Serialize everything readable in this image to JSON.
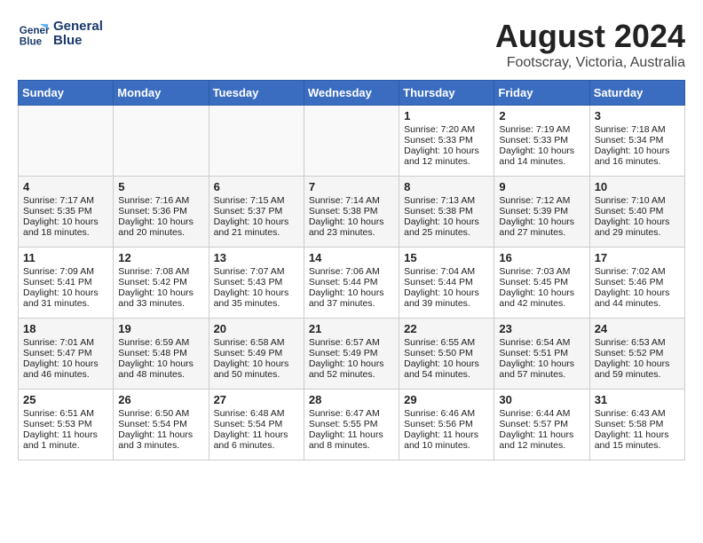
{
  "header": {
    "logo_line1": "General",
    "logo_line2": "Blue",
    "month": "August 2024",
    "location": "Footscray, Victoria, Australia"
  },
  "days_of_week": [
    "Sunday",
    "Monday",
    "Tuesday",
    "Wednesday",
    "Thursday",
    "Friday",
    "Saturday"
  ],
  "weeks": [
    [
      {
        "day": "",
        "content": ""
      },
      {
        "day": "",
        "content": ""
      },
      {
        "day": "",
        "content": ""
      },
      {
        "day": "",
        "content": ""
      },
      {
        "day": "1",
        "content": "Sunrise: 7:20 AM\nSunset: 5:33 PM\nDaylight: 10 hours\nand 12 minutes."
      },
      {
        "day": "2",
        "content": "Sunrise: 7:19 AM\nSunset: 5:33 PM\nDaylight: 10 hours\nand 14 minutes."
      },
      {
        "day": "3",
        "content": "Sunrise: 7:18 AM\nSunset: 5:34 PM\nDaylight: 10 hours\nand 16 minutes."
      }
    ],
    [
      {
        "day": "4",
        "content": "Sunrise: 7:17 AM\nSunset: 5:35 PM\nDaylight: 10 hours\nand 18 minutes."
      },
      {
        "day": "5",
        "content": "Sunrise: 7:16 AM\nSunset: 5:36 PM\nDaylight: 10 hours\nand 20 minutes."
      },
      {
        "day": "6",
        "content": "Sunrise: 7:15 AM\nSunset: 5:37 PM\nDaylight: 10 hours\nand 21 minutes."
      },
      {
        "day": "7",
        "content": "Sunrise: 7:14 AM\nSunset: 5:38 PM\nDaylight: 10 hours\nand 23 minutes."
      },
      {
        "day": "8",
        "content": "Sunrise: 7:13 AM\nSunset: 5:38 PM\nDaylight: 10 hours\nand 25 minutes."
      },
      {
        "day": "9",
        "content": "Sunrise: 7:12 AM\nSunset: 5:39 PM\nDaylight: 10 hours\nand 27 minutes."
      },
      {
        "day": "10",
        "content": "Sunrise: 7:10 AM\nSunset: 5:40 PM\nDaylight: 10 hours\nand 29 minutes."
      }
    ],
    [
      {
        "day": "11",
        "content": "Sunrise: 7:09 AM\nSunset: 5:41 PM\nDaylight: 10 hours\nand 31 minutes."
      },
      {
        "day": "12",
        "content": "Sunrise: 7:08 AM\nSunset: 5:42 PM\nDaylight: 10 hours\nand 33 minutes."
      },
      {
        "day": "13",
        "content": "Sunrise: 7:07 AM\nSunset: 5:43 PM\nDaylight: 10 hours\nand 35 minutes."
      },
      {
        "day": "14",
        "content": "Sunrise: 7:06 AM\nSunset: 5:44 PM\nDaylight: 10 hours\nand 37 minutes."
      },
      {
        "day": "15",
        "content": "Sunrise: 7:04 AM\nSunset: 5:44 PM\nDaylight: 10 hours\nand 39 minutes."
      },
      {
        "day": "16",
        "content": "Sunrise: 7:03 AM\nSunset: 5:45 PM\nDaylight: 10 hours\nand 42 minutes."
      },
      {
        "day": "17",
        "content": "Sunrise: 7:02 AM\nSunset: 5:46 PM\nDaylight: 10 hours\nand 44 minutes."
      }
    ],
    [
      {
        "day": "18",
        "content": "Sunrise: 7:01 AM\nSunset: 5:47 PM\nDaylight: 10 hours\nand 46 minutes."
      },
      {
        "day": "19",
        "content": "Sunrise: 6:59 AM\nSunset: 5:48 PM\nDaylight: 10 hours\nand 48 minutes."
      },
      {
        "day": "20",
        "content": "Sunrise: 6:58 AM\nSunset: 5:49 PM\nDaylight: 10 hours\nand 50 minutes."
      },
      {
        "day": "21",
        "content": "Sunrise: 6:57 AM\nSunset: 5:49 PM\nDaylight: 10 hours\nand 52 minutes."
      },
      {
        "day": "22",
        "content": "Sunrise: 6:55 AM\nSunset: 5:50 PM\nDaylight: 10 hours\nand 54 minutes."
      },
      {
        "day": "23",
        "content": "Sunrise: 6:54 AM\nSunset: 5:51 PM\nDaylight: 10 hours\nand 57 minutes."
      },
      {
        "day": "24",
        "content": "Sunrise: 6:53 AM\nSunset: 5:52 PM\nDaylight: 10 hours\nand 59 minutes."
      }
    ],
    [
      {
        "day": "25",
        "content": "Sunrise: 6:51 AM\nSunset: 5:53 PM\nDaylight: 11 hours\nand 1 minute."
      },
      {
        "day": "26",
        "content": "Sunrise: 6:50 AM\nSunset: 5:54 PM\nDaylight: 11 hours\nand 3 minutes."
      },
      {
        "day": "27",
        "content": "Sunrise: 6:48 AM\nSunset: 5:54 PM\nDaylight: 11 hours\nand 6 minutes."
      },
      {
        "day": "28",
        "content": "Sunrise: 6:47 AM\nSunset: 5:55 PM\nDaylight: 11 hours\nand 8 minutes."
      },
      {
        "day": "29",
        "content": "Sunrise: 6:46 AM\nSunset: 5:56 PM\nDaylight: 11 hours\nand 10 minutes."
      },
      {
        "day": "30",
        "content": "Sunrise: 6:44 AM\nSunset: 5:57 PM\nDaylight: 11 hours\nand 12 minutes."
      },
      {
        "day": "31",
        "content": "Sunrise: 6:43 AM\nSunset: 5:58 PM\nDaylight: 11 hours\nand 15 minutes."
      }
    ]
  ]
}
